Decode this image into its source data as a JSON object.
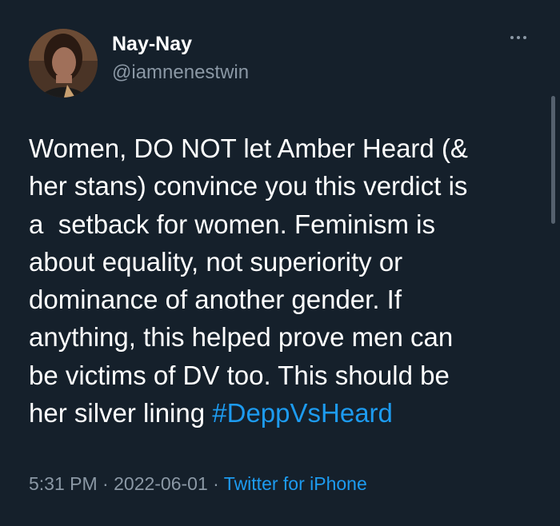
{
  "author": {
    "display_name": "Nay-Nay",
    "handle": "@iamnenestwin"
  },
  "tweet": {
    "lines": [
      "Women, DO NOT let Amber Heard (&",
      "her stans) convince you this verdict is",
      "a  setback for women. Feminism is",
      "about equality, not superiority or",
      "dominance of another gender. If",
      "anything, this helped prove men can",
      "be victims of DV too. This should be",
      "her silver lining "
    ],
    "hashtag": "#DeppVsHeard"
  },
  "meta": {
    "time": "5:31 PM",
    "separator": " · ",
    "date": "2022-06-01",
    "source": "Twitter for iPhone"
  },
  "colors": {
    "background": "#15202b",
    "text": "#ffffff",
    "secondary": "#8b98a5",
    "link": "#1d9bf0"
  },
  "icons": {
    "more": "more-dots-icon"
  }
}
